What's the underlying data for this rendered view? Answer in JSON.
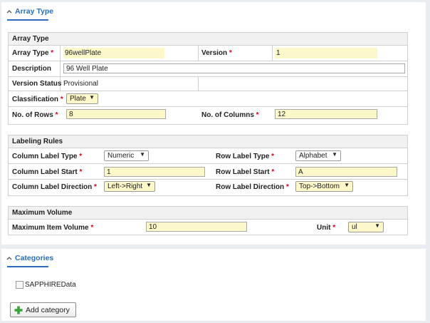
{
  "array_panel": {
    "title": "Array Type",
    "sections": {
      "array_type": {
        "title": "Array Type",
        "array_type_label": "Array Type",
        "array_type_value": "96wellPlate",
        "version_label": "Version",
        "version_value": "1",
        "description_label": "Description",
        "description_value": "96 Well Plate",
        "version_status_label": "Version Status",
        "version_status_value": "Provisional",
        "classification_label": "Classification",
        "classification_value": "Plate",
        "rows_label": "No. of Rows",
        "rows_value": "8",
        "columns_label": "No. of Columns",
        "columns_value": "12"
      },
      "labeling_rules": {
        "title": "Labeling Rules",
        "col_label_type_label": "Column Label Type",
        "col_label_type_value": "Numeric",
        "row_label_type_label": "Row Label Type",
        "row_label_type_value": "Alphabet",
        "col_label_start_label": "Column Label Start",
        "col_label_start_value": "1",
        "row_label_start_label": "Row Label Start",
        "row_label_start_value": "A",
        "col_label_dir_label": "Column Label Direction",
        "col_label_dir_value": "Left->Right",
        "row_label_dir_label": "Row Label Direction",
        "row_label_dir_value": "Top->Bottom"
      },
      "max_volume": {
        "title": "Maximum Volume",
        "max_item_volume_label": "Maximum Item Volume",
        "max_item_volume_value": "10",
        "unit_label": "Unit",
        "unit_value": "ul"
      }
    }
  },
  "categories_panel": {
    "title": "Categories",
    "items": [
      {
        "label": "SAPPHIREData",
        "checked": false
      }
    ],
    "add_button_label": "Add category"
  },
  "required_marker": "*",
  "colors": {
    "accent": "#2a6ebb",
    "required": "#d0021b",
    "highlight": "#fdf8c9",
    "add_icon": "#3aa33a"
  },
  "icons": {
    "collapse": "chevron-up-icon",
    "add": "plus-icon",
    "dropdown": "caret-down-icon"
  }
}
